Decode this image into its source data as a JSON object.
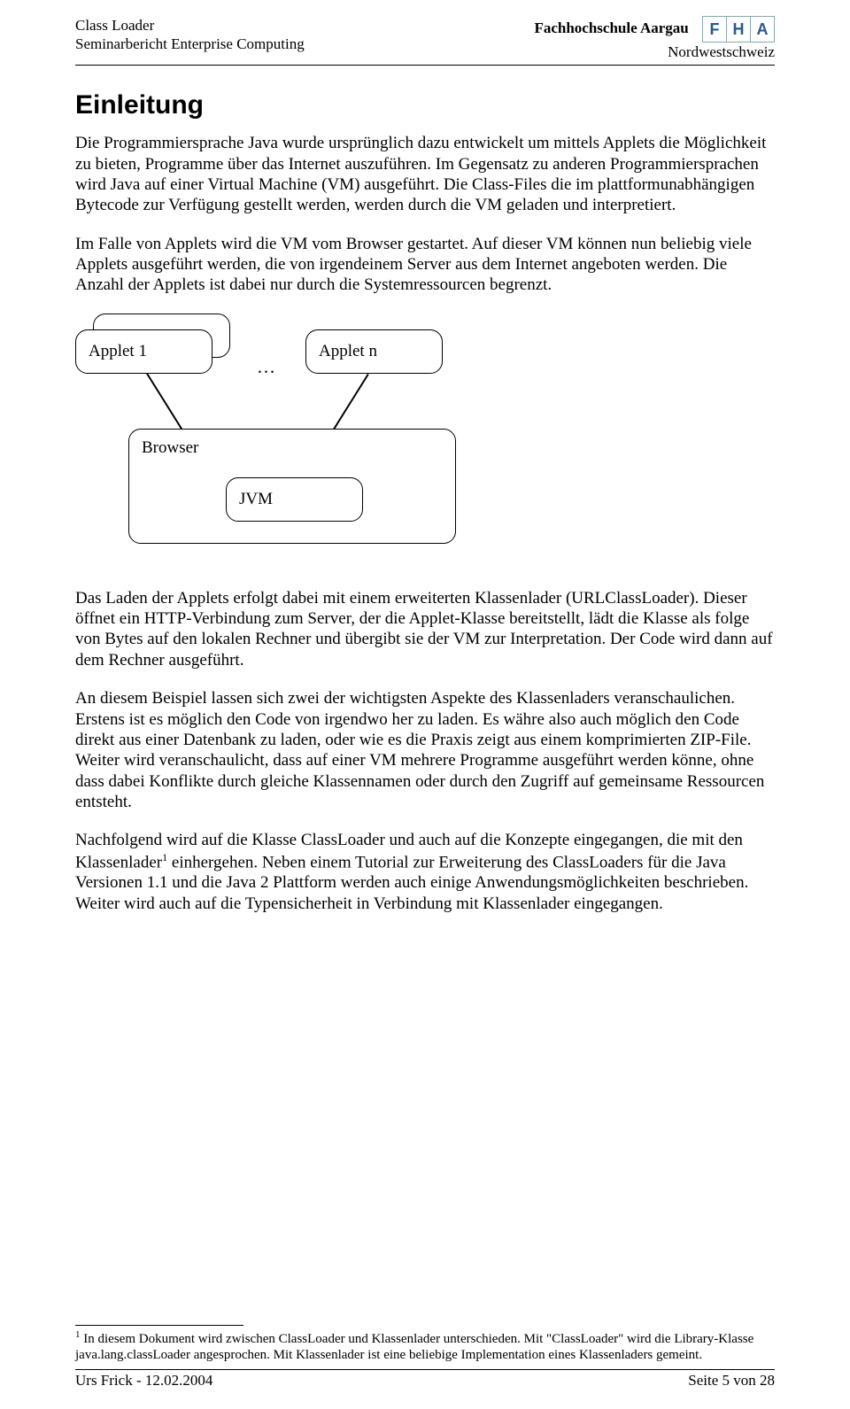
{
  "header": {
    "left_line1": "Class Loader",
    "left_line2": "Seminarbericht Enterprise Computing",
    "right_line1": "Fachhochschule Aargau",
    "right_line2": "Nordwestschweiz",
    "logo_letters": [
      "F",
      "H",
      "A"
    ]
  },
  "title": "Einleitung",
  "para1": "Die Programmiersprache Java wurde ursprünglich dazu entwickelt um mittels Applets die Möglichkeit zu bieten, Programme über das Internet auszuführen. Im Gegensatz zu anderen Programmiersprachen wird Java auf einer Virtual Machine (VM) ausgeführt. Die Class-Files die im plattformunabhängigen Bytecode zur Verfügung gestellt werden, werden durch die VM geladen und interpretiert.",
  "para2": "Im Falle von Applets wird die VM vom Browser gestartet. Auf dieser VM können nun beliebig viele Applets ausgeführt werden, die von irgendeinem Server aus dem Internet angeboten werden. Die Anzahl der Applets ist dabei nur durch die Systemressourcen begrenzt.",
  "diagram": {
    "applet1": "Applet 1",
    "appletn": "Applet n",
    "browser": "Browser",
    "jvm": "JVM",
    "ellipsis": "…"
  },
  "para3": "Das Laden der Applets erfolgt dabei mit einem erweiterten Klassenlader (URLClassLoader). Dieser öffnet ein HTTP-Verbindung zum Server, der die Applet-Klasse bereitstellt, lädt die Klasse als folge von Bytes auf den lokalen Rechner und übergibt sie der VM zur Interpretation. Der Code wird dann auf dem Rechner ausgeführt.",
  "para4": "An diesem Beispiel lassen sich zwei der wichtigsten Aspekte des Klassenladers veranschaulichen. Erstens ist es möglich den Code von irgendwo her zu laden. Es währe also auch möglich den Code direkt aus einer Datenbank zu laden, oder wie es die Praxis zeigt aus einem komprimierten ZIP-File. Weiter wird veranschaulicht, dass auf einer VM mehrere Programme ausgeführt werden könne, ohne dass dabei Konflikte durch gleiche Klassennamen oder durch den Zugriff auf gemeinsame Ressourcen entsteht.",
  "para5a": "Nachfolgend wird auf die Klasse ClassLoader und auch auf die Konzepte eingegangen, die mit den Klassenlader",
  "para5b": " einhergehen. Neben einem Tutorial zur Erweiterung des ClassLoaders für die Java Versionen 1.1 und die Java 2 Plattform werden auch einige Anwendungsmöglichkeiten beschrieben. Weiter wird auch auf die Typensicherheit in Verbindung mit Klassenlader eingegangen.",
  "footnote_marker": "1",
  "footnote": " In diesem Dokument wird zwischen ClassLoader und Klassenlader unterschieden. Mit \"ClassLoader\" wird die Library-Klasse java.lang.classLoader angesprochen. Mit Klassenlader ist eine beliebige Implementation eines Klassenladers gemeint.",
  "footer": {
    "left": "Urs Frick - 12.02.2004",
    "right": "Seite 5 von 28"
  }
}
